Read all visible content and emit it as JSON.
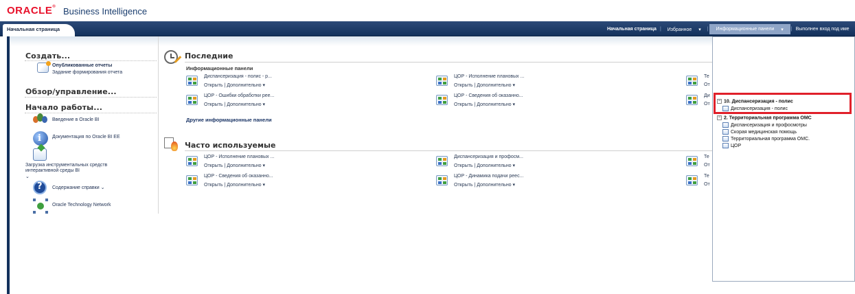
{
  "header": {
    "logo": "ORACLE",
    "product": "Business Intelligence"
  },
  "tabbar": {
    "tab_home": "Начальная страница",
    "nav_home": "Начальная страница",
    "nav_favorites": "Избранное",
    "nav_dashboards": "Информационные панели",
    "nav_user": "Выполнен вход под име"
  },
  "left": {
    "create_title": "Создать...",
    "published_reports": "Опубликованные отчеты",
    "report_task": "Задание формирования отчета",
    "browse_title": "Обзор/управление...",
    "start_title": "Начало работы...",
    "intro": "Введение в Oracle BI",
    "docs": "Документация по Oracle BI EE",
    "download_line1": "Загрузка инструментальных средств",
    "download_line2": "интерактивной среды BI",
    "help": "Содержание справки",
    "otn": "Oracle Technology Network"
  },
  "recent": {
    "title": "Последние",
    "subtitle": "Информационные панели",
    "items": [
      {
        "title": "Диспансеризация - полис - р...",
        "actions": "Открыть | Дополнительно"
      },
      {
        "title": "ЦОР - Исполнение плановых ...",
        "actions": "Открыть | Дополнительно"
      },
      {
        "title": "Те",
        "actions": "От"
      },
      {
        "title": "ЦОР - Ошибки обработки рее...",
        "actions": "Открыть | Дополнительно"
      },
      {
        "title": "ЦОР - Сведения об оказанно...",
        "actions": "Открыть | Дополнительно"
      },
      {
        "title": "Ди",
        "actions": "От"
      }
    ],
    "more": "Другие информационные панели"
  },
  "frequent": {
    "title": "Часто используемые",
    "items": [
      {
        "title": "ЦОР - Исполнение плановых ...",
        "actions": "Открыть | Дополнительно"
      },
      {
        "title": "Диспансеризация и профосм...",
        "actions": "Открыть | Дополнительно"
      },
      {
        "title": "Те",
        "actions": "От"
      },
      {
        "title": "ЦОР - Сведения об оказанно...",
        "actions": "Открыть | Дополнительно"
      },
      {
        "title": "ЦОР - Динамика подачи реес...",
        "actions": "Открыть | Дополнительно"
      },
      {
        "title": "Те",
        "actions": "От"
      }
    ]
  },
  "dropdown": {
    "group1": "10. Диспансеризация - полис",
    "group1_items": [
      "Диспансеризация - полис"
    ],
    "group2": "2. Территориальная программа ОМС",
    "group2_items": [
      "Диспансеризация и профосмотры",
      "Скорая медицинская помощь",
      "Территориальная программа ОМС.",
      "ЦОР"
    ]
  },
  "colors": {
    "brand_red": "#e8102a",
    "nav_blue": "#13315c",
    "highlight": "#e0202a"
  }
}
